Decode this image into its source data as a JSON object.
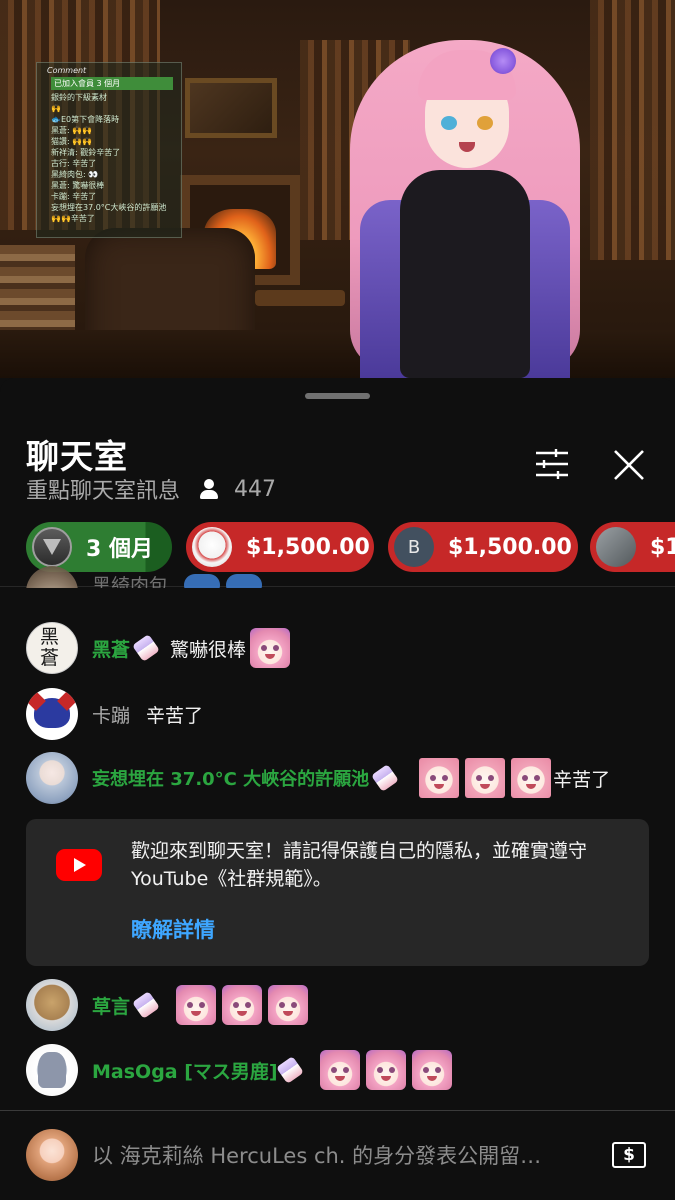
{
  "video": {
    "overlay": {
      "title": "Comment",
      "first": "已加入會員 3 個月",
      "lines": [
        "銀鈴的下級素材",
        "🙌",
        "🐟E0第下會降落時",
        "黑蒼: 🙌🙌",
        "猫讚: 🙌🙌",
        "新祥清: 觀鈴辛苦了",
        "古行: 辛苦了",
        "黑綺肉包: 👀",
        "黑蒼: 驚嚇很棒",
        "卡蹦: 辛苦了",
        "妄想埋在37.0°C大峽谷的許願池",
        "🙌🙌辛苦了"
      ]
    }
  },
  "chat": {
    "title": "聊天室",
    "subtitle": "重點聊天室訊息",
    "viewer_count": "447",
    "icons": {
      "filter": "sliders-icon",
      "close": "close-icon",
      "person": "person-icon"
    },
    "ticker": [
      {
        "type": "membership",
        "label": "3 個月",
        "color": "#2e7d32"
      },
      {
        "type": "superchat",
        "label": "$1,500.00",
        "color": "#c62828"
      },
      {
        "type": "superchat",
        "label": "$1,500.00",
        "avatar_letter": "B",
        "color": "#c62828"
      },
      {
        "type": "superchat",
        "label": "$1",
        "color": "#c62828"
      }
    ],
    "messages": [
      {
        "name": "黑綺肉包",
        "text": "",
        "partial": true
      },
      {
        "name": "黑蒼",
        "text": "驚嚇很棒",
        "member": true
      },
      {
        "name": "卡蹦",
        "text": "辛苦了",
        "member": false
      },
      {
        "name": "妄想埋在 37.0°C 大峽谷的許願池",
        "text": "辛苦了",
        "member": true
      },
      {
        "name": "草言",
        "text": "",
        "member": true
      },
      {
        "name": "MasOga [マス男鹿]",
        "text": "",
        "member": true
      }
    ],
    "welcome": {
      "text": "歡迎來到聊天室！請記得保護自己的隱私，並確實遵守 YouTube《社群規範》。",
      "link": "瞭解詳情"
    },
    "input": {
      "placeholder": "以 海克莉絲 HercuLes ch. 的身分發表公開留…",
      "superchat_icon": "$"
    }
  }
}
